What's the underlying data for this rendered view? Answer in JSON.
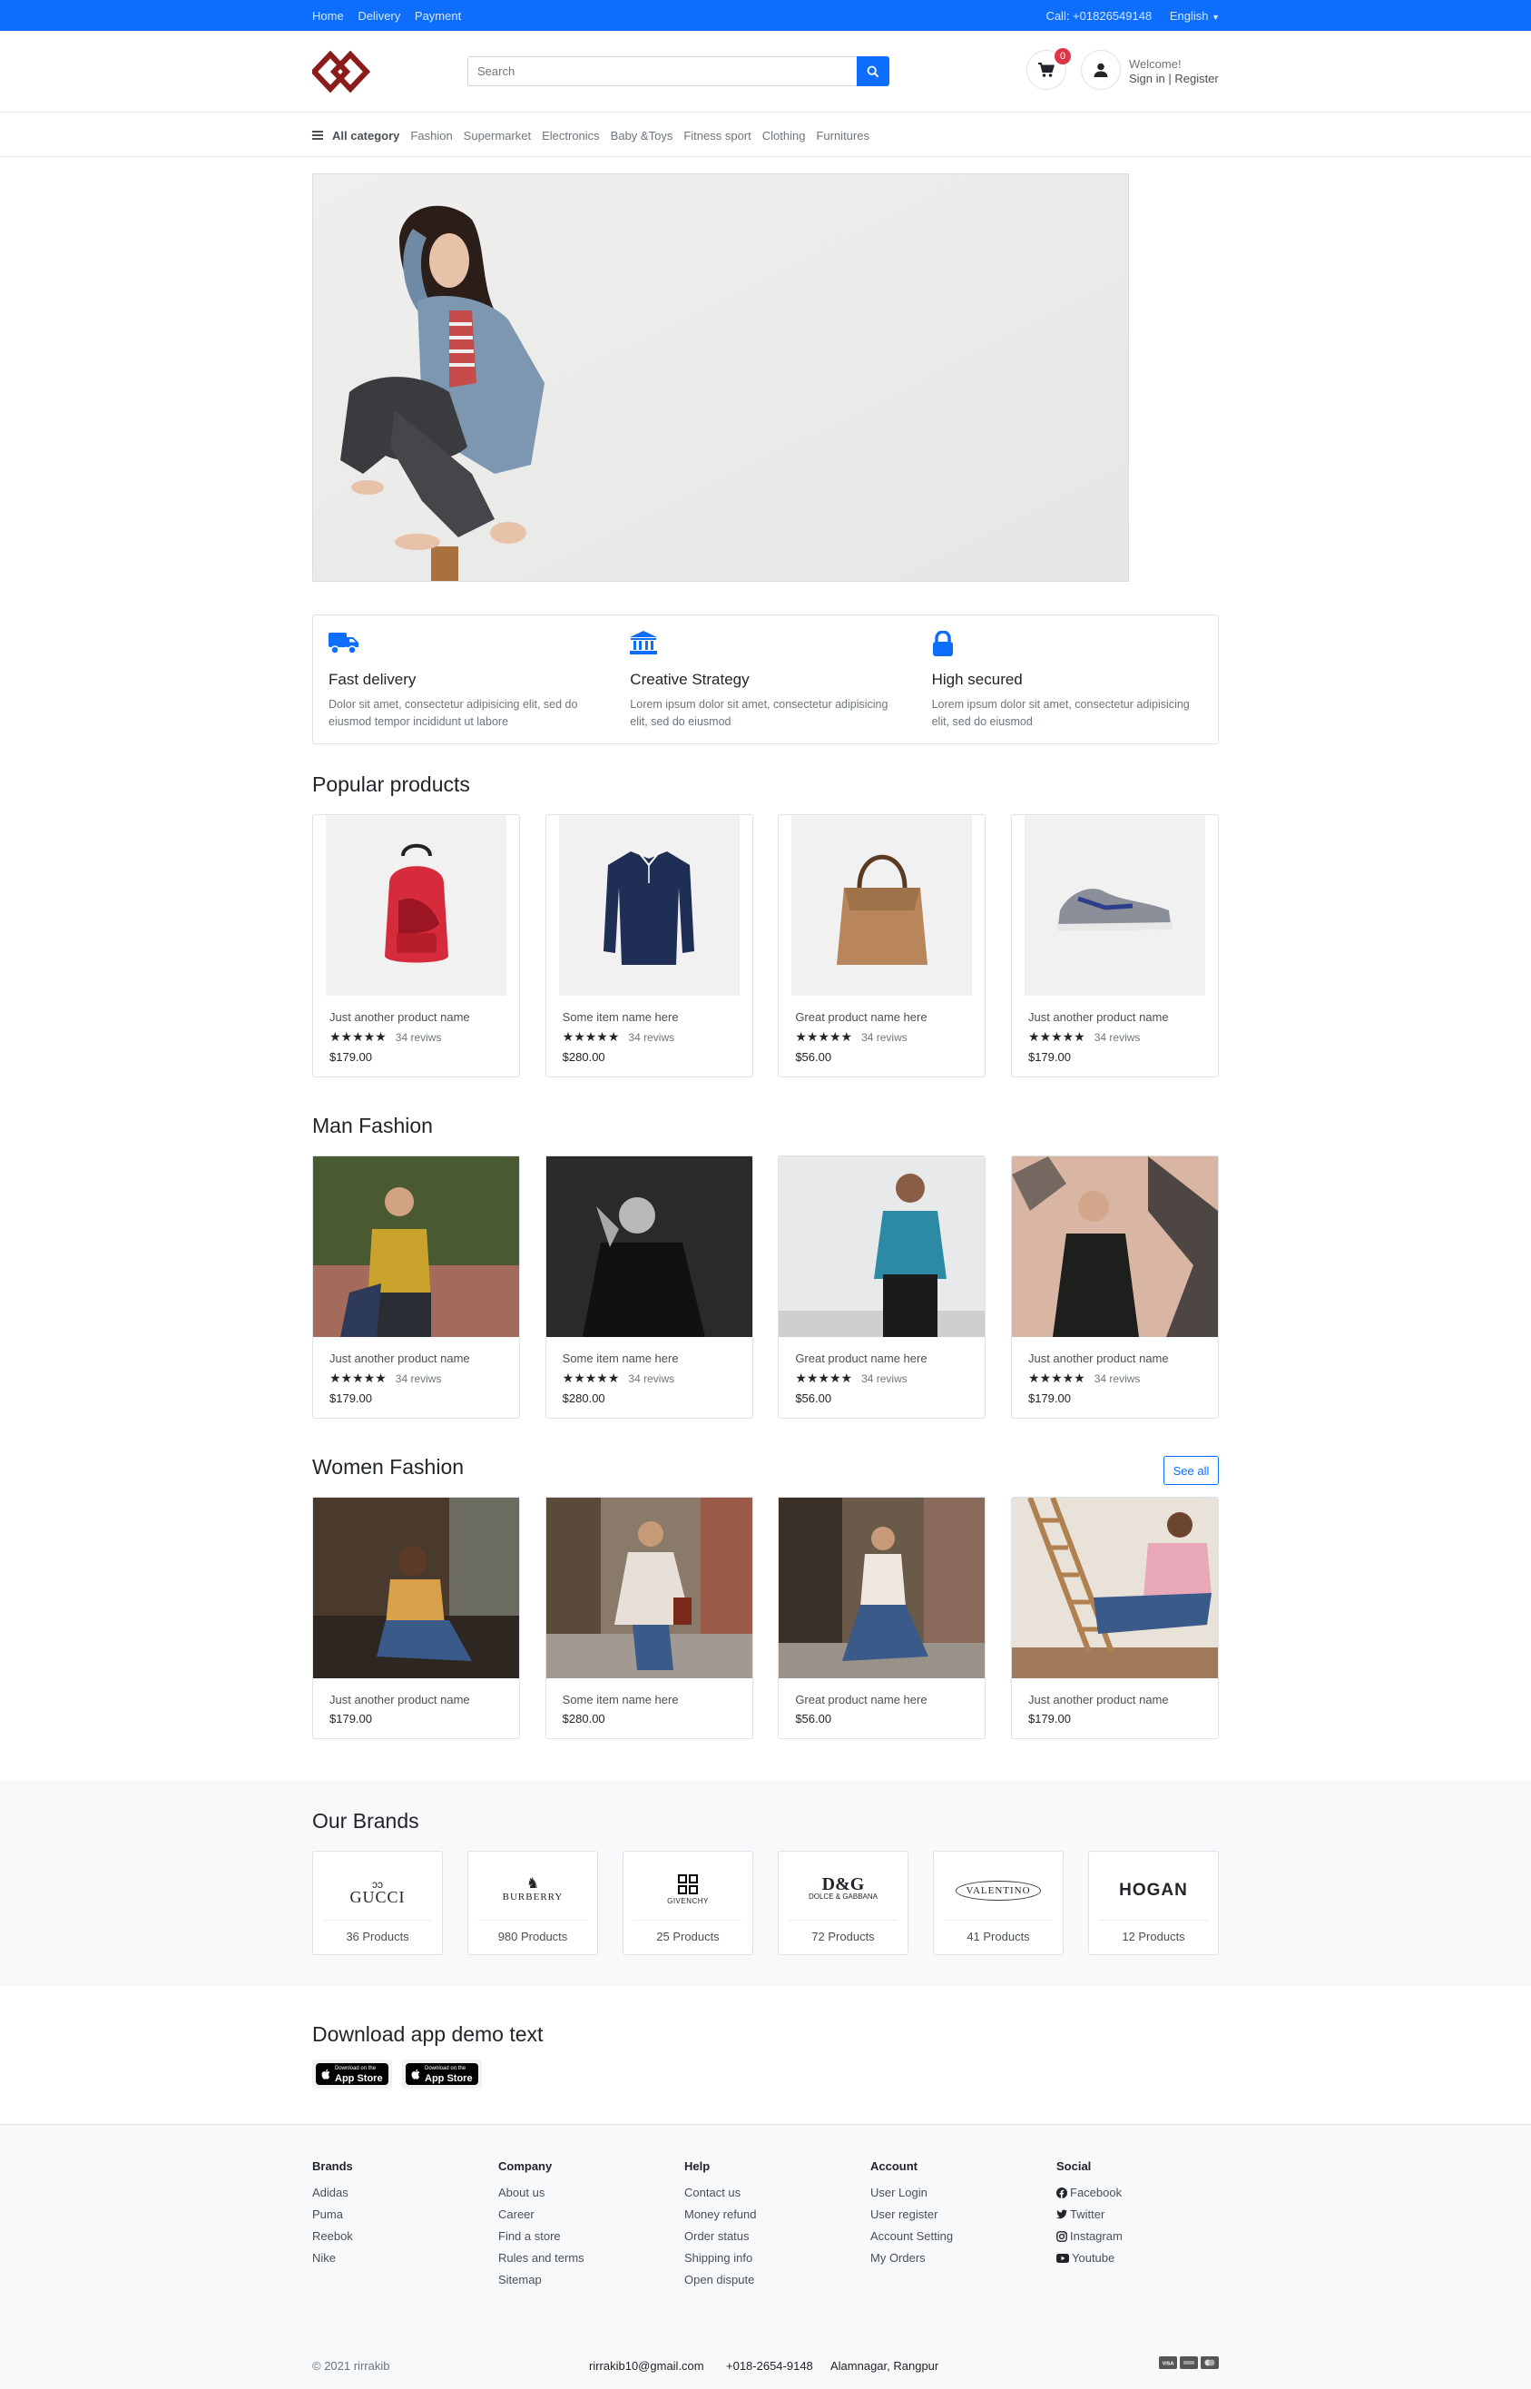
{
  "topbar": {
    "links": [
      "Home",
      "Delivery",
      "Payment"
    ],
    "call": "Call: +01826549148",
    "language": "English"
  },
  "header": {
    "search_placeholder": "Search",
    "cart_count": "0",
    "welcome": "Welcome!",
    "signin": "Sign in | Register"
  },
  "catnav": {
    "all": "All category",
    "items": [
      "Fashion",
      "Supermarket",
      "Electronics",
      "Baby &Toys",
      "Fitness sport",
      "Clothing",
      "Furnitures"
    ]
  },
  "features": [
    {
      "title": "Fast delivery",
      "desc": "Dolor sit amet, consectetur adipisicing elit, sed do eiusmod tempor incididunt ut labore",
      "icon": "truck-icon"
    },
    {
      "title": "Creative Strategy",
      "desc": "Lorem ipsum dolor sit amet, consectetur adipisicing elit, sed do eiusmod",
      "icon": "bank-icon"
    },
    {
      "title": "High secured",
      "desc": "Lorem ipsum dolor sit amet, consectetur adipisicing elit, sed do eiusmod",
      "icon": "lock-icon"
    }
  ],
  "popular": {
    "title": "Popular products",
    "items": [
      {
        "name": "Just another product name",
        "reviews": "34 reviws",
        "price": "$179.00",
        "rating": 5
      },
      {
        "name": "Some item name here",
        "reviews": "34 reviws",
        "price": "$280.00",
        "rating": 5
      },
      {
        "name": "Great product name here",
        "reviews": "34 reviws",
        "price": "$56.00",
        "rating": 5
      },
      {
        "name": "Just another product name",
        "reviews": "34 reviws",
        "price": "$179.00",
        "rating": 5
      }
    ]
  },
  "man": {
    "title": "Man Fashion",
    "items": [
      {
        "name": "Just another product name",
        "reviews": "34 reviws",
        "price": "$179.00",
        "rating": 5
      },
      {
        "name": "Some item name here",
        "reviews": "34 reviws",
        "price": "$280.00",
        "rating": 5
      },
      {
        "name": "Great product name here",
        "reviews": "34 reviws",
        "price": "$56.00",
        "rating": 5
      },
      {
        "name": "Just another product name",
        "reviews": "34 reviws",
        "price": "$179.00",
        "rating": 5
      }
    ]
  },
  "women": {
    "title": "Women Fashion",
    "see_all": "See all",
    "items": [
      {
        "name": "Just another product name",
        "price": "$179.00"
      },
      {
        "name": "Some item name here",
        "price": "$280.00"
      },
      {
        "name": "Great product name here",
        "price": "$56.00"
      },
      {
        "name": "Just another product name",
        "price": "$179.00"
      }
    ]
  },
  "brands": {
    "title": "Our Brands",
    "items": [
      {
        "name": "GUCCI",
        "count": "36 Products"
      },
      {
        "name": "BURBERRY",
        "count": "980 Products"
      },
      {
        "name": "GIVENCHY",
        "count": "25 Products"
      },
      {
        "name": "D&G",
        "sub": "DOLCE & GABBANA",
        "count": "72 Products"
      },
      {
        "name": "VALENTINO",
        "count": "41 Products"
      },
      {
        "name": "HOGAN",
        "count": "12 Products"
      }
    ]
  },
  "download": {
    "title": "Download app demo text",
    "small": "Download on the",
    "store": "App Store"
  },
  "footer": {
    "cols": [
      {
        "title": "Brands",
        "links": [
          "Adidas",
          "Puma",
          "Reebok",
          "Nike"
        ]
      },
      {
        "title": "Company",
        "links": [
          "About us",
          "Career",
          "Find a store",
          "Rules and terms",
          "Sitemap"
        ]
      },
      {
        "title": "Help",
        "links": [
          "Contact us",
          "Money refund",
          "Order status",
          "Shipping info",
          "Open dispute"
        ]
      },
      {
        "title": "Account",
        "links": [
          "User Login",
          "User register",
          "Account Setting",
          "My Orders"
        ]
      },
      {
        "title": "Social",
        "links": [
          "Facebook",
          "Twitter",
          "Instagram",
          "Youtube"
        ]
      }
    ],
    "copyright": "© 2021 rirrakib",
    "email": "rirrakib10@gmail.com",
    "phone": "+018-2654-9148",
    "address": "Alamnagar, Rangpur"
  },
  "colors": {
    "accent": "#0d6efd",
    "logo": "#8b1c1c",
    "badge": "#dc3545"
  }
}
